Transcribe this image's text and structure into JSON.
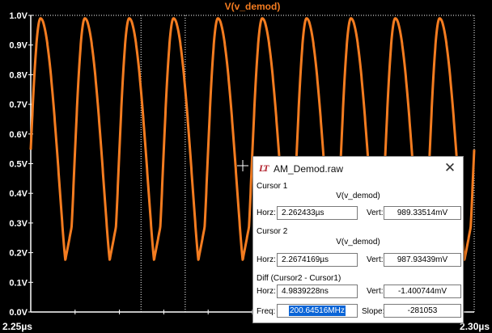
{
  "plot": {
    "title": "V(v_demod)",
    "y_ticks": [
      "0.0V",
      "0.1V",
      "0.2V",
      "0.3V",
      "0.4V",
      "0.5V",
      "0.6V",
      "0.7V",
      "0.8V",
      "0.9V",
      "1.0V"
    ],
    "x_ticks": [
      "2.25µs",
      "2.30µs"
    ],
    "colors": {
      "background": "#000000",
      "trace": "#f47c20",
      "axis": "#ffffff",
      "title": "#f47c20"
    },
    "cursor_icon": "crosshair-cursor-icon"
  },
  "chart_data": {
    "type": "line",
    "title": "V(v_demod)",
    "x_range": [
      "2.25µs",
      "2.30µs"
    ],
    "ylim": [
      0.0,
      1.0
    ],
    "y_unit": "V",
    "series": [
      {
        "name": "V(v_demod)",
        "color": "#f47c20",
        "peaks_x_us": [
          2.2561,
          2.2611,
          2.2661,
          2.2711,
          2.2761,
          2.2811,
          2.2861,
          2.2911,
          2.2961
        ],
        "peak_value": 0.99,
        "valley_value": 0.175
      }
    ],
    "cursors_x_us": [
      2.262433,
      2.2674169
    ]
  },
  "dialog": {
    "title": "AM_Demod.raw",
    "close_glyph": "✕",
    "icon_text": "LT",
    "cursor1": {
      "label": "Cursor 1",
      "trace": "V(v_demod)",
      "horz_label": "Horz:",
      "horz_value": "2.262433µs",
      "vert_label": "Vert:",
      "vert_value": "989.33514mV"
    },
    "cursor2": {
      "label": "Cursor 2",
      "trace": "V(v_demod)",
      "horz_label": "Horz:",
      "horz_value": "2.2674169µs",
      "vert_label": "Vert:",
      "vert_value": "987.93439mV"
    },
    "diff": {
      "label": "Diff (Cursor2 - Cursor1)",
      "horz_label": "Horz:",
      "horz_value": "4.9839228ns",
      "vert_label": "Vert:",
      "vert_value": "-1.400744mV",
      "freq_label": "Freq:",
      "freq_value": "200.64516MHz",
      "slope_label": "Slope:",
      "slope_value": "-281053"
    }
  }
}
